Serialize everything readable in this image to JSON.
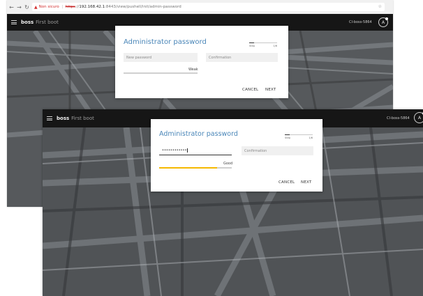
{
  "browser": {
    "back_icon": "back-arrow-icon",
    "forward_icon": "forward-arrow-icon",
    "reload_icon": "reload-icon",
    "security_label": "Non sicuro",
    "url_protocol": "https",
    "url_host": "192.168.42.1",
    "url_rest": ":8443/view/pushell/init/admin-password"
  },
  "app": {
    "name": "boss",
    "subtitle": "First boot",
    "host": "CI-boss-5864",
    "avatar_letter": "A"
  },
  "dialog_weak": {
    "title": "Administrator password",
    "step_label": "Step",
    "step_count": "1/6",
    "step_fraction": 0.17,
    "password_placeholder": "New password",
    "confirmation_placeholder": "Confirmation",
    "strength_label": "Weak",
    "strength_fraction": 0.0,
    "cancel_label": "CANCEL",
    "next_label": "NEXT"
  },
  "dialog_good": {
    "title": "Administrator password",
    "step_label": "Step",
    "step_count": "1/6",
    "step_fraction": 0.17,
    "password_value": "••••••••••••",
    "confirmation_placeholder": "Confirmation",
    "strength_label": "Good",
    "strength_fraction": 0.8,
    "strength_color": "#f5b800",
    "cancel_label": "CANCEL",
    "next_label": "NEXT"
  },
  "colors": {
    "accent": "#4a86b8",
    "appbar": "#161616",
    "warning": "#d32f2f"
  }
}
